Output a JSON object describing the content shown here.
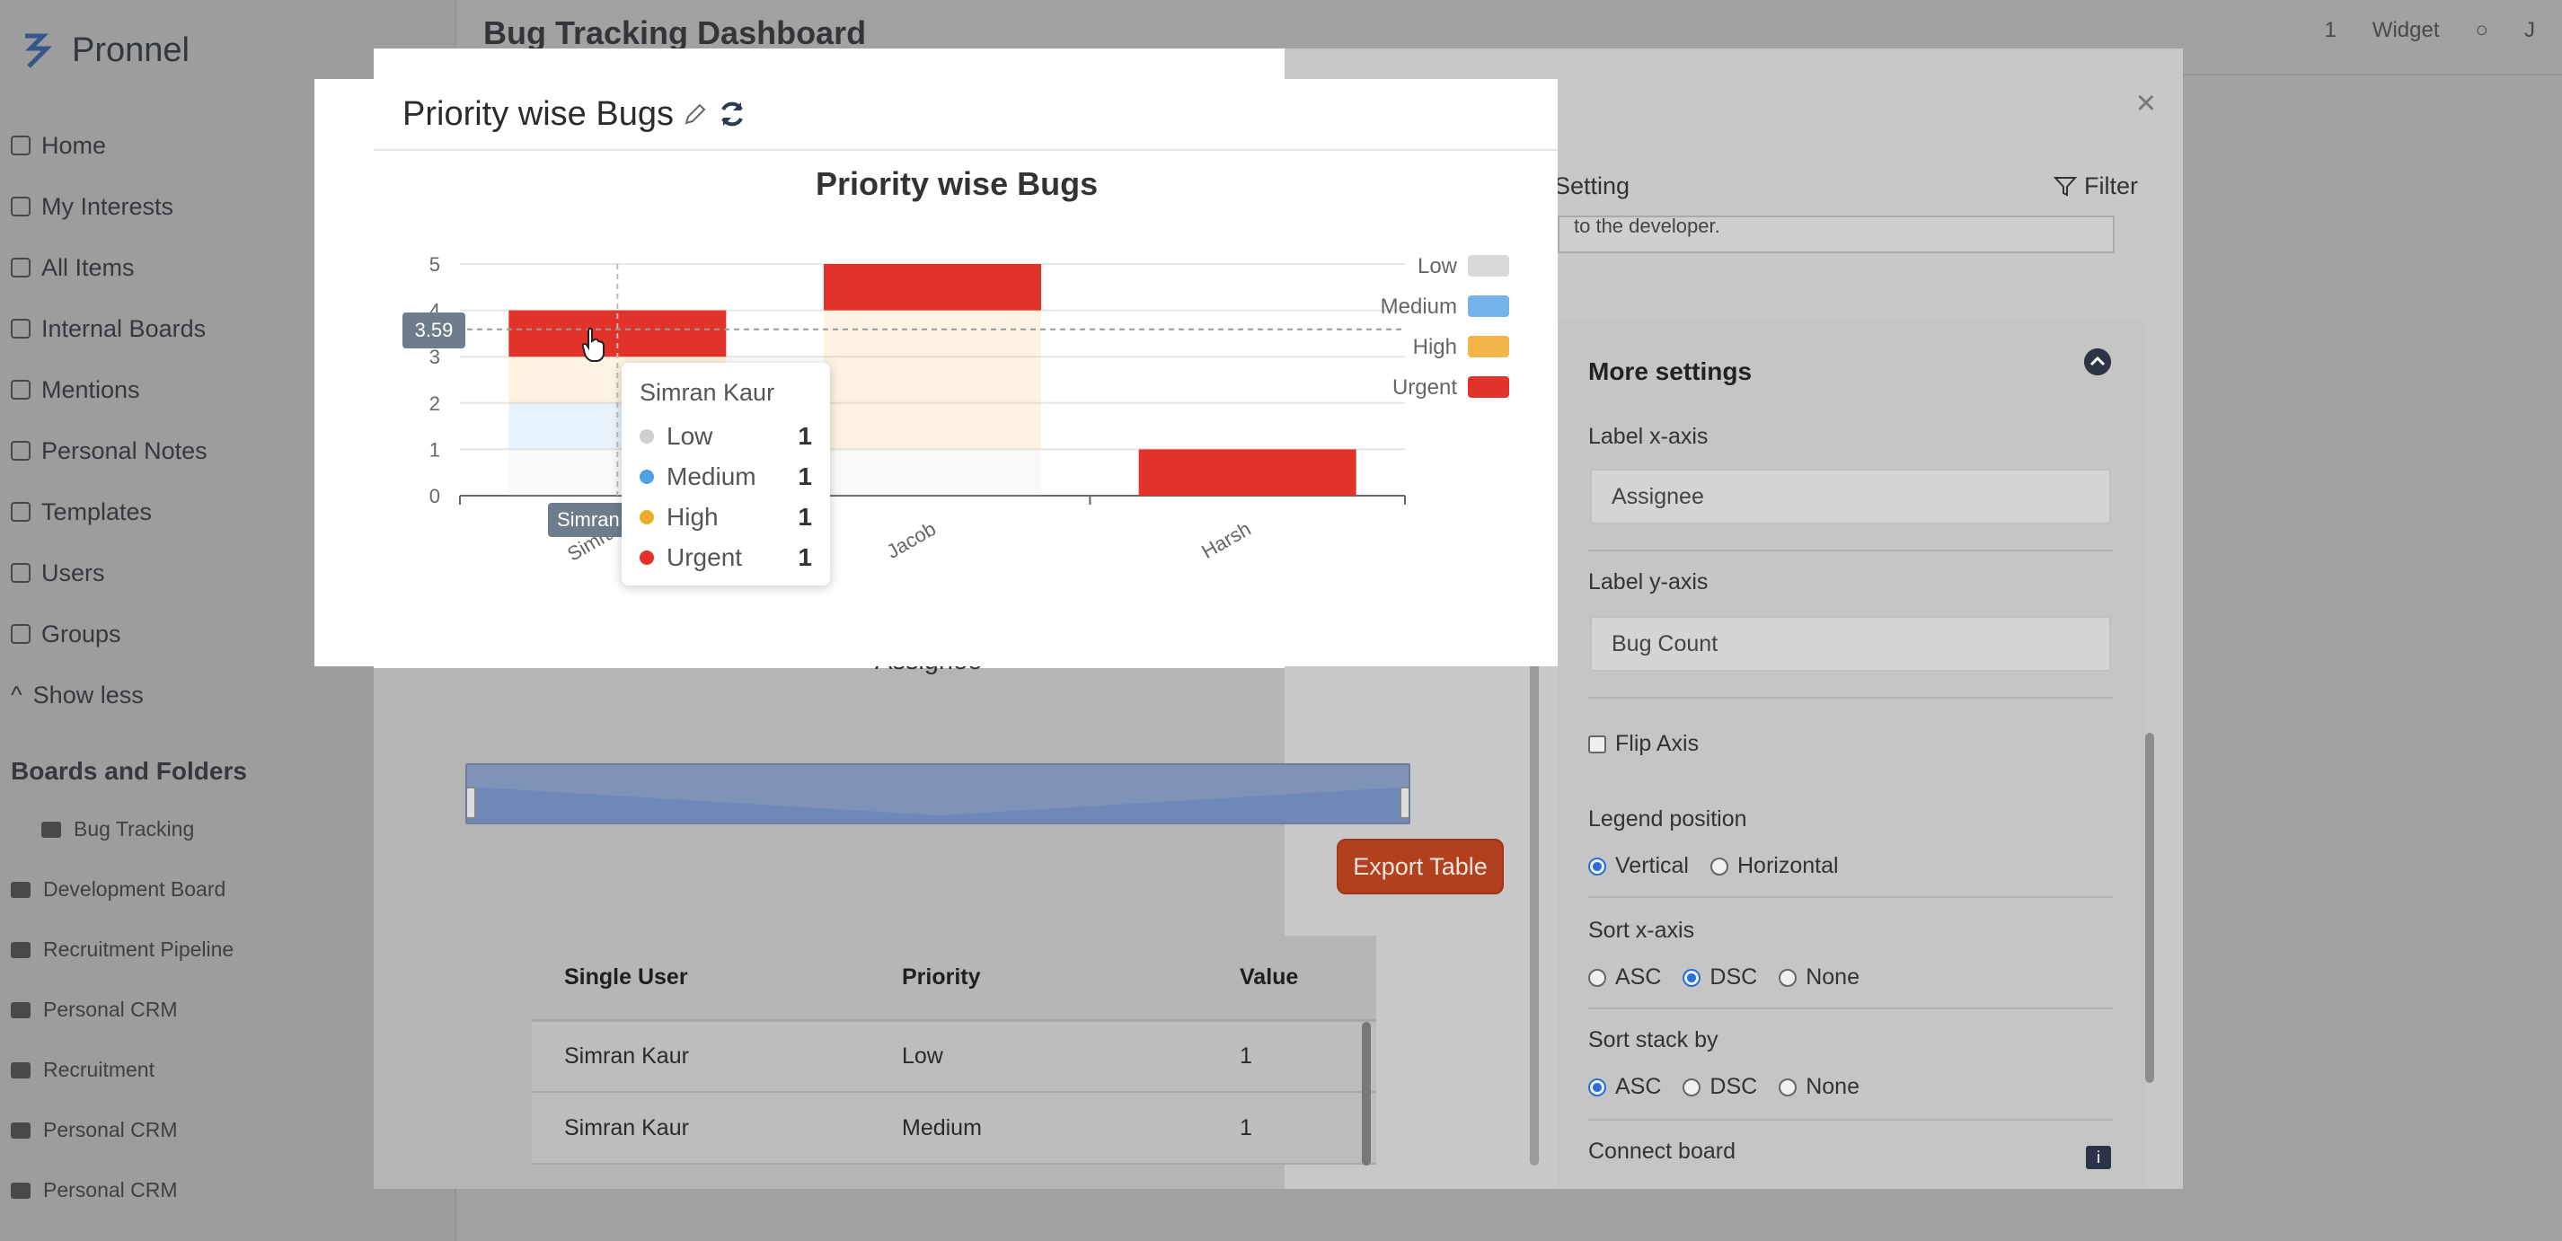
{
  "app": {
    "brand": "Pronnel",
    "page_title": "Bug Tracking Dashboard",
    "topbar": {
      "counter": "1",
      "widget_label": "Widget",
      "avatar_letter": "J"
    },
    "nav": [
      "Home",
      "My Interests",
      "All Items",
      "Internal Boards",
      "Mentions",
      "Personal Notes",
      "Templates",
      "Users",
      "Groups",
      "Show less"
    ],
    "boards_title": "Boards and Folders",
    "boards": [
      {
        "label": "Bug Tracking",
        "sub": true
      },
      {
        "label": "Development Board",
        "sub": false
      },
      {
        "label": "Recruitment Pipeline",
        "sub": false
      },
      {
        "label": "Personal CRM",
        "sub": false
      },
      {
        "label": "Recruitment",
        "sub": false
      },
      {
        "label": "Personal CRM",
        "sub": false
      },
      {
        "label": "Personal CRM",
        "sub": false
      }
    ]
  },
  "modal": {
    "title": "Priority wise Bugs",
    "close": "×",
    "setting_label": "Setting",
    "filter_label": "Filter",
    "export_label": "Export Table",
    "table": {
      "headers": [
        "Single User",
        "Priority",
        "Value"
      ],
      "rows": [
        [
          "Simran Kaur",
          "Low",
          "1"
        ],
        [
          "Simran Kaur",
          "Medium",
          "1"
        ]
      ]
    }
  },
  "chart_data": {
    "type": "bar",
    "stacked": true,
    "title": "Priority wise Bugs",
    "xlabel": "Assignee",
    "ylabel": "",
    "ylim": [
      0,
      5
    ],
    "yticks": [
      "0",
      "1",
      "2",
      "3",
      "4",
      "5"
    ],
    "categories": [
      "Simran Kaur",
      "Jacob",
      "Harsh"
    ],
    "category_tick_labels": [
      "Simran",
      "Jacob",
      "Harsh"
    ],
    "series": [
      {
        "name": "Low",
        "color": "#d9d9d9",
        "values": [
          1,
          1,
          0
        ]
      },
      {
        "name": "Medium",
        "color": "#74b4ea",
        "values": [
          1,
          0,
          0
        ]
      },
      {
        "name": "High",
        "color": "#f3b54a",
        "values": [
          1,
          3,
          0
        ]
      },
      {
        "name": "Urgent",
        "color": "#e1332a",
        "values": [
          1,
          1,
          1
        ]
      }
    ],
    "legend_position": "right",
    "pointer_value": "3.59",
    "axis_pointer_label": "Simran",
    "tooltip": {
      "name": "Simran Kaur",
      "rows": [
        {
          "label": "Low",
          "value": "1",
          "color": "#d0d0d0"
        },
        {
          "label": "Medium",
          "value": "1",
          "color": "#4ea3e6"
        },
        {
          "label": "High",
          "value": "1",
          "color": "#f0ab2c"
        },
        {
          "label": "Urgent",
          "value": "1",
          "color": "#e1332a"
        }
      ]
    }
  },
  "settings": {
    "note_text": "to the developer.",
    "more_settings": "More settings",
    "label_x_axis": "Label x-axis",
    "label_x_value": "Assignee",
    "label_y_axis": "Label y-axis",
    "label_y_value": "Bug Count",
    "flip_axis": "Flip Axis",
    "legend_position": "Legend position",
    "legend_opts": [
      "Vertical",
      "Horizontal"
    ],
    "sort_x": "Sort x-axis",
    "sort_x_opts": [
      "ASC",
      "DSC",
      "None"
    ],
    "sort_stack": "Sort stack by",
    "sort_stack_opts": [
      "ASC",
      "DSC",
      "None"
    ],
    "connect_board": "Connect board"
  }
}
